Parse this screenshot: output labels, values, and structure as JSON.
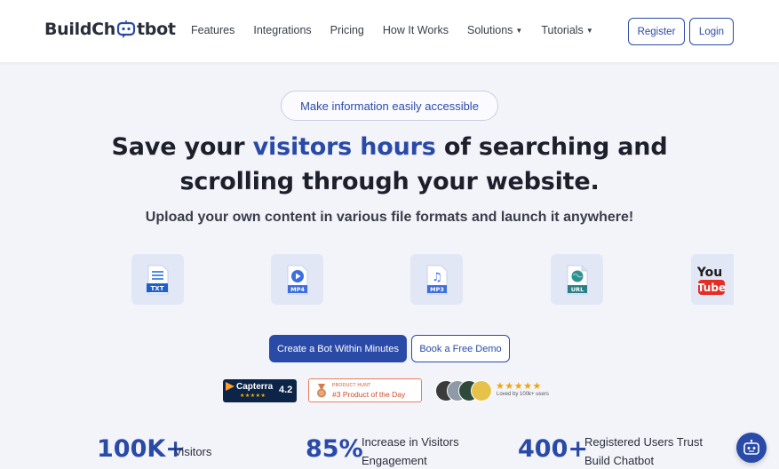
{
  "brand": {
    "logo_text_before": "BuildCh",
    "logo_text_after": "tbot"
  },
  "nav": {
    "features": "Features",
    "integrations": "Integrations",
    "pricing": "Pricing",
    "how_it_works": "How It Works",
    "solutions": "Solutions",
    "tutorials": "Tutorials"
  },
  "auth": {
    "register": "Register",
    "login": "Login"
  },
  "hero": {
    "pill": "Make information easily accessible",
    "headline_1": "Save your ",
    "headline_accent": "visitors hours",
    "headline_2": " of searching and",
    "headline_3": "scrolling through your website.",
    "subhead": "Upload your own content in various file formats and launch it anywhere!"
  },
  "formats": [
    {
      "icon": "txt-file-icon",
      "label": "TXT"
    },
    {
      "icon": "mp4-file-icon",
      "label": "MP4"
    },
    {
      "icon": "mp3-file-icon",
      "label": "MP3"
    },
    {
      "icon": "url-file-icon",
      "label": "URL"
    },
    {
      "icon": "youtube-icon",
      "label_top": "You",
      "label_bottom": "Tube"
    }
  ],
  "cta": {
    "primary": "Create a Bot Within Minutes",
    "secondary": "Book a Free Demo"
  },
  "badges": {
    "capterra_name": "Capterra",
    "capterra_stars": "★★★★★",
    "capterra_rating": "4.2",
    "ph_small": "PRODUCT HUNT",
    "ph_big": "#3 Product of the Day",
    "user_stars": "★★★★★",
    "loved": "Loved by 100k+ users"
  },
  "stats": [
    {
      "value": "100K+",
      "label": "Visitors"
    },
    {
      "value": "85%",
      "label_1": "Increase in Visitors",
      "label_2": "Engagement"
    },
    {
      "value": "400+",
      "label_1": "Registered Users Trust",
      "label_2": "Build Chatbot"
    }
  ],
  "colors": {
    "accent": "#2a4aa8",
    "background": "#f3f4fa",
    "card": "#e2e7f6"
  }
}
